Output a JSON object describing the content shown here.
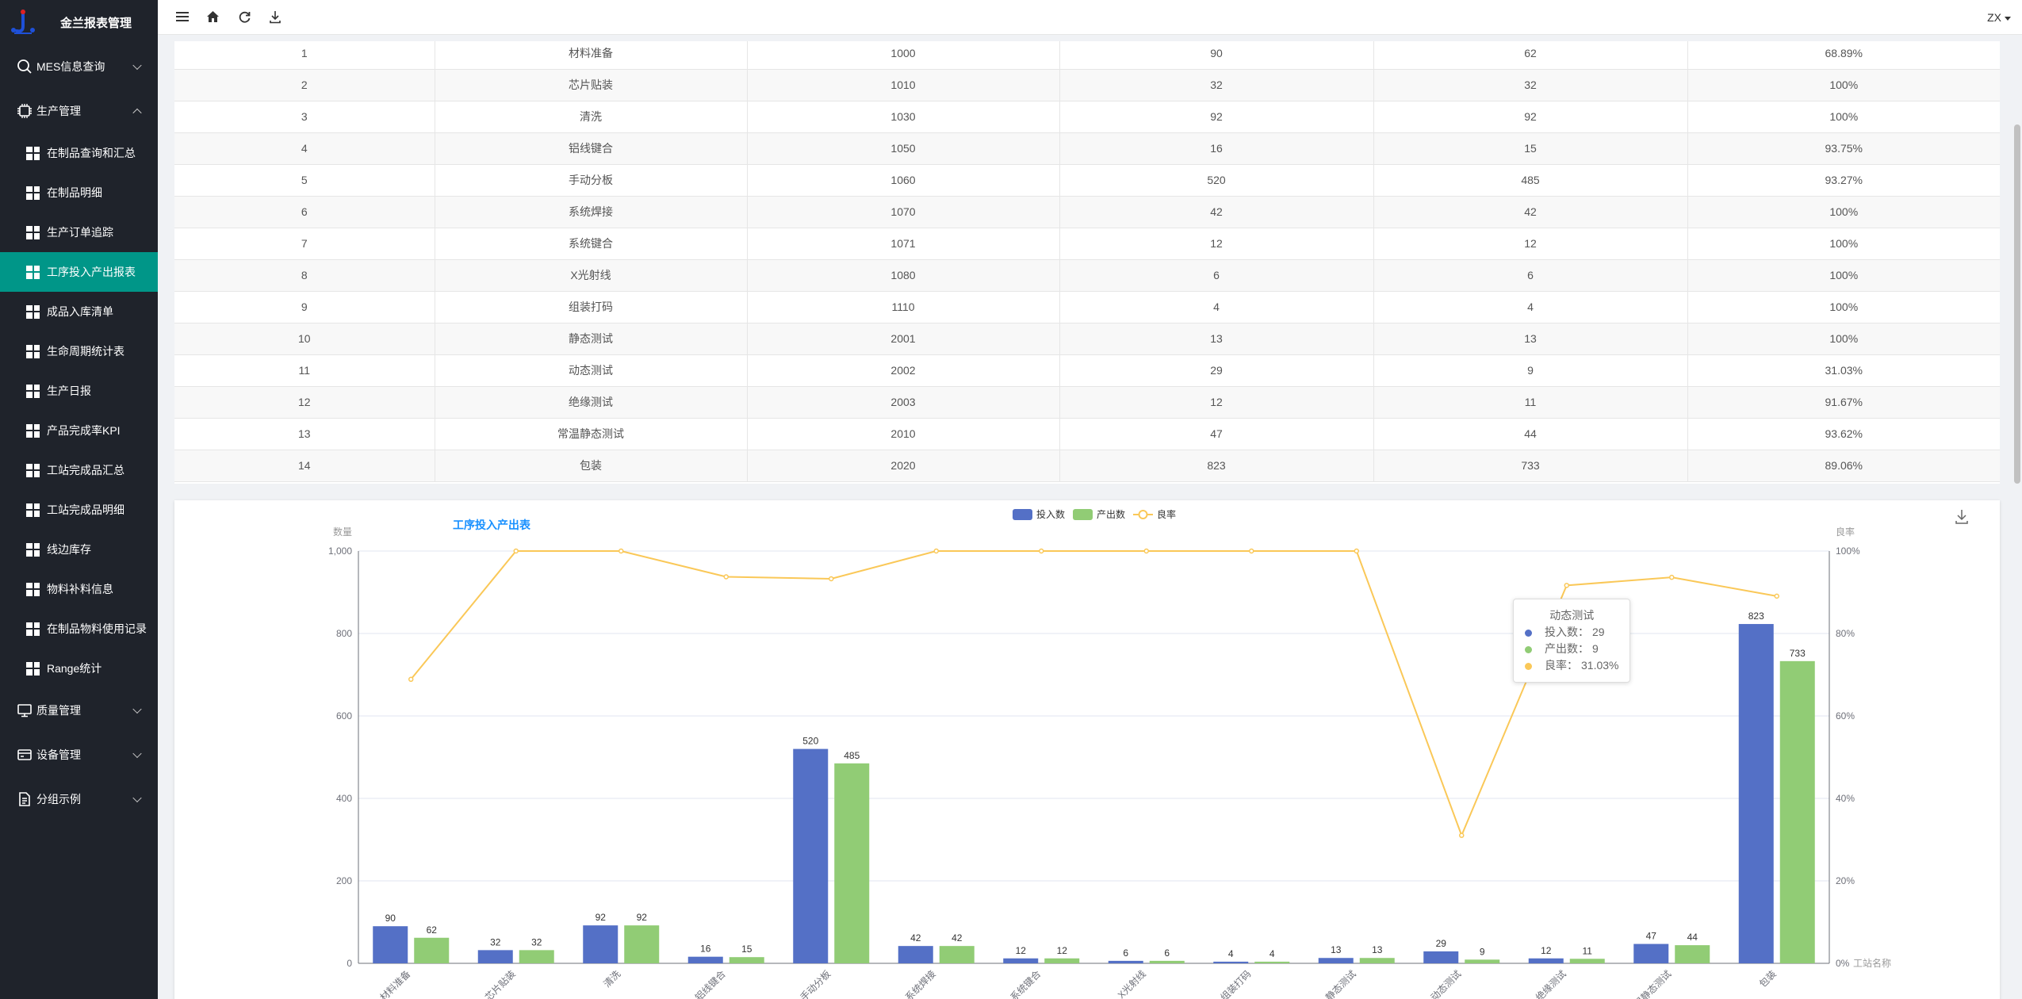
{
  "app": {
    "title": "金兰报表管理"
  },
  "sidebar": {
    "groups": [
      {
        "label": "MES信息查询",
        "icon": "search-icon",
        "expanded": false
      },
      {
        "label": "生产管理",
        "icon": "chip-icon",
        "expanded": true
      },
      {
        "label": "质量管理",
        "icon": "monitor-icon",
        "expanded": false
      },
      {
        "label": "设备管理",
        "icon": "card-icon",
        "expanded": false
      },
      {
        "label": "分组示例",
        "icon": "document-icon",
        "expanded": false
      }
    ],
    "items": [
      {
        "label": "在制品查询和汇总"
      },
      {
        "label": "在制品明细"
      },
      {
        "label": "生产订单追踪"
      },
      {
        "label": "工序投入产出报表"
      },
      {
        "label": "成品入库清单"
      },
      {
        "label": "生命周期统计表"
      },
      {
        "label": "生产日报"
      },
      {
        "label": "产品完成率KPI"
      },
      {
        "label": "工站完成品汇总"
      },
      {
        "label": "工站完成品明细"
      },
      {
        "label": "线边库存"
      },
      {
        "label": "物料补料信息"
      },
      {
        "label": "在制品物料使用记录"
      },
      {
        "label": "Range统计"
      }
    ],
    "active_item": "工序投入产出报表",
    "active_color": "#009688"
  },
  "header": {
    "icons": [
      "menu-icon",
      "home-icon",
      "refresh-icon",
      "download-icon"
    ],
    "user": "ZX"
  },
  "table": {
    "rows": [
      [
        "1",
        "材料准备",
        "1000",
        "90",
        "62",
        "68.89%"
      ],
      [
        "2",
        "芯片贴装",
        "1010",
        "32",
        "32",
        "100%"
      ],
      [
        "3",
        "清洗",
        "1030",
        "92",
        "92",
        "100%"
      ],
      [
        "4",
        "铝线键合",
        "1050",
        "16",
        "15",
        "93.75%"
      ],
      [
        "5",
        "手动分板",
        "1060",
        "520",
        "485",
        "93.27%"
      ],
      [
        "6",
        "系统焊接",
        "1070",
        "42",
        "42",
        "100%"
      ],
      [
        "7",
        "系统键合",
        "1071",
        "12",
        "12",
        "100%"
      ],
      [
        "8",
        "X光射线",
        "1080",
        "6",
        "6",
        "100%"
      ],
      [
        "9",
        "组装打码",
        "1110",
        "4",
        "4",
        "100%"
      ],
      [
        "10",
        "静态测试",
        "2001",
        "13",
        "13",
        "100%"
      ],
      [
        "11",
        "动态测试",
        "2002",
        "29",
        "9",
        "31.03%"
      ],
      [
        "12",
        "绝缘测试",
        "2003",
        "12",
        "11",
        "91.67%"
      ],
      [
        "13",
        "常温静态测试",
        "2010",
        "47",
        "44",
        "93.62%"
      ],
      [
        "14",
        "包装",
        "2020",
        "823",
        "733",
        "89.06%"
      ]
    ]
  },
  "chart_data": {
    "type": "bar",
    "title": "工序投入产出表",
    "categories": [
      "材料准备",
      "芯片贴装",
      "清洗",
      "铝线键合",
      "手动分板",
      "系统焊接",
      "系统键合",
      "X光射线",
      "组装打码",
      "静态测试",
      "动态测试",
      "绝缘测试",
      "常温静态测试",
      "包装"
    ],
    "series": [
      {
        "name": "投入数",
        "type": "bar",
        "color": "#5470c6",
        "values": [
          90,
          32,
          92,
          16,
          520,
          42,
          12,
          6,
          4,
          13,
          29,
          12,
          47,
          823
        ]
      },
      {
        "name": "产出数",
        "type": "bar",
        "color": "#91cc75",
        "values": [
          62,
          32,
          92,
          15,
          485,
          42,
          12,
          6,
          4,
          13,
          9,
          11,
          44,
          733
        ]
      },
      {
        "name": "良率",
        "type": "line",
        "color": "#fac858",
        "values": [
          68.89,
          100,
          100,
          93.75,
          93.27,
          100,
          100,
          100,
          100,
          100,
          31.03,
          91.67,
          93.62,
          89.06
        ]
      }
    ],
    "ylabel": "数量",
    "ylim": [
      0,
      1000
    ],
    "yticks": [
      "0",
      "200",
      "400",
      "600",
      "800",
      "1,000"
    ],
    "y2label": "良率",
    "y2lim": [
      0,
      100
    ],
    "y2ticks": [
      "0%",
      "20%",
      "40%",
      "60%",
      "80%",
      "100%"
    ],
    "xlabel": "工站名称",
    "legend": "top-center",
    "grid": true
  },
  "tooltip": {
    "title": "动态测试",
    "lines": [
      {
        "label": "投入数：",
        "value": "29",
        "color": "#5470c6"
      },
      {
        "label": "产出数：",
        "value": "9",
        "color": "#91cc75"
      },
      {
        "label": "良率：",
        "value": "31.03%",
        "color": "#fac858"
      }
    ]
  }
}
